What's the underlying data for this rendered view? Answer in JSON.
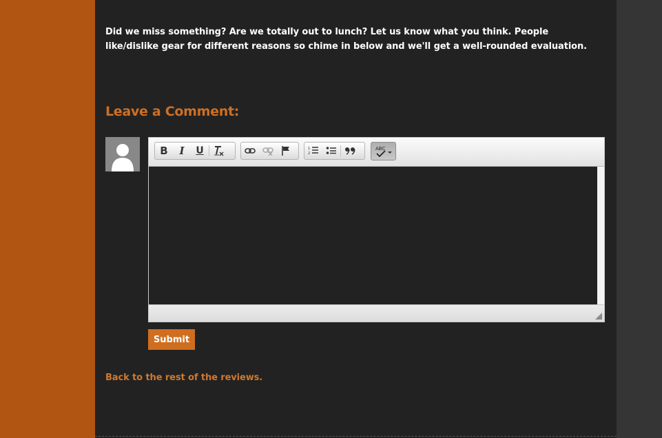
{
  "intro": {
    "text": "Did we miss something? Are we totally out to lunch? Let us know what you think. People like/dislike gear for different reasons so chime in below and we'll get a well-rounded evaluation."
  },
  "comment": {
    "heading": "Leave a Comment:",
    "toolbar": {
      "bold_label": "B",
      "italic_label": "I",
      "underline_label": "U",
      "icons": [
        "bold-icon",
        "italic-icon",
        "underline-icon",
        "remove-format-icon",
        "link-icon",
        "unlink-icon",
        "anchor-flag-icon",
        "numbered-list-icon",
        "bulleted-list-icon",
        "blockquote-icon",
        "spellcheck-icon"
      ]
    },
    "editor_value": "",
    "submit_label": "Submit"
  },
  "back_link": "Back to the rest of the reviews.",
  "colors": {
    "accent": "#cf6e1f",
    "sidebar": "#b05612",
    "background": "#222222",
    "right_gutter": "#353535"
  }
}
